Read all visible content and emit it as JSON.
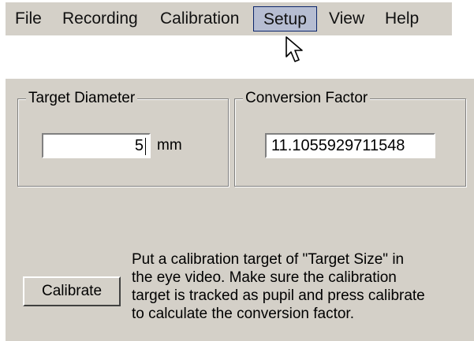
{
  "menu": {
    "items": [
      {
        "label": "File"
      },
      {
        "label": "Recording"
      },
      {
        "label": "Calibration"
      },
      {
        "label": "Setup"
      },
      {
        "label": "View"
      },
      {
        "label": "Help"
      }
    ],
    "active_item": "Setup"
  },
  "target_diameter": {
    "group_label": "Target Diameter",
    "value": "5",
    "unit": "mm"
  },
  "conversion_factor": {
    "group_label": "Conversion Factor",
    "value": "11.1055929711548"
  },
  "calibrate_button": {
    "label": "Calibrate"
  },
  "instructions": {
    "lines": [
      "Put a calibration target of \"Target Size\" in",
      "the eye video. Make sure the calibration",
      "target is tracked as pupil and press calibrate",
      "to calculate the conversion factor."
    ]
  },
  "colors": {
    "dialog_bg": "#d4d0c8",
    "menu_highlight": "#b6bdd2",
    "menu_highlight_border": "#0a246a"
  }
}
